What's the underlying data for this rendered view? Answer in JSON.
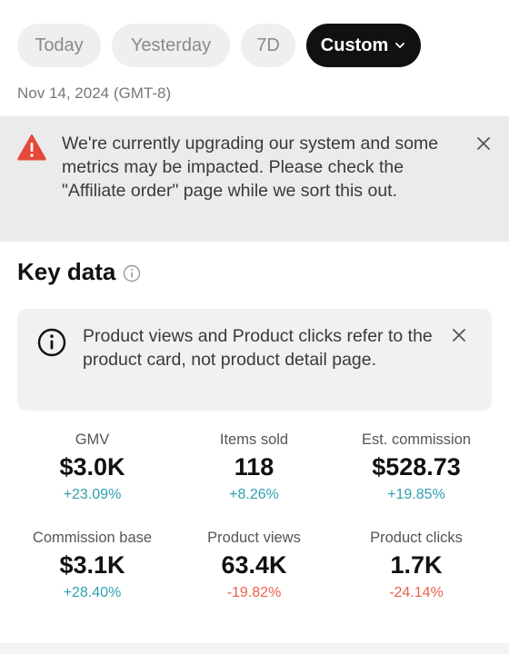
{
  "date_range": {
    "options": [
      {
        "label": "Today"
      },
      {
        "label": "Yesterday"
      },
      {
        "label": "7D"
      },
      {
        "label": "Custom",
        "selected": true
      }
    ],
    "date_text": "Nov 14, 2024 (GMT-8)"
  },
  "warning_banner": {
    "message": "We're currently upgrading our system and some metrics may be impacted. Please check the \"Affiliate order\" page while we sort this out.",
    "icon": "warning-icon"
  },
  "key_data": {
    "title": "Key data",
    "notice": "Product views and Product clicks refer to the product card, not product detail page.",
    "metrics": [
      {
        "label": "GMV",
        "value": "$3.0K",
        "change": "+23.09%",
        "trend": "up"
      },
      {
        "label": "Items sold",
        "value": "118",
        "change": "+8.26%",
        "trend": "up"
      },
      {
        "label": "Est. commission",
        "value": "$528.73",
        "change": "+19.85%",
        "trend": "up"
      },
      {
        "label": "Commission base",
        "value": "$3.1K",
        "change": "+28.40%",
        "trend": "up"
      },
      {
        "label": "Product views",
        "value": "63.4K",
        "change": "-19.82%",
        "trend": "down"
      },
      {
        "label": "Product clicks",
        "value": "1.7K",
        "change": "-24.14%",
        "trend": "down"
      }
    ]
  },
  "colors": {
    "positive": "#2f9fae",
    "negative": "#e8604c",
    "warning": "#e5483a",
    "selected_pill": "#111111"
  }
}
